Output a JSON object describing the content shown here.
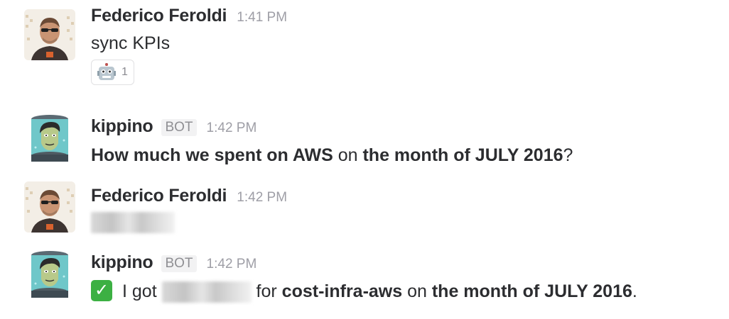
{
  "messages": [
    {
      "author": "Federico Feroldi",
      "time": "1:41 PM",
      "text": "sync KPIs",
      "reaction": {
        "emoji": "robot-face",
        "count": "1"
      }
    },
    {
      "author": "kippino",
      "badge": "BOT",
      "time": "1:42 PM",
      "text_parts": [
        "How much we spent on ",
        "AWS",
        " on ",
        "the month of JULY 2016",
        "?"
      ]
    },
    {
      "author": "Federico Feroldi",
      "time": "1:42 PM"
    },
    {
      "author": "kippino",
      "badge": "BOT",
      "time": "1:42 PM",
      "text_parts": [
        "I got ",
        " for ",
        "cost-infra-aws",
        " on ",
        "the month of JULY 2016",
        "."
      ]
    }
  ],
  "colors": {
    "name": "#2c2d30",
    "timestamp": "#9e9ea6",
    "check": "#3cb043"
  }
}
